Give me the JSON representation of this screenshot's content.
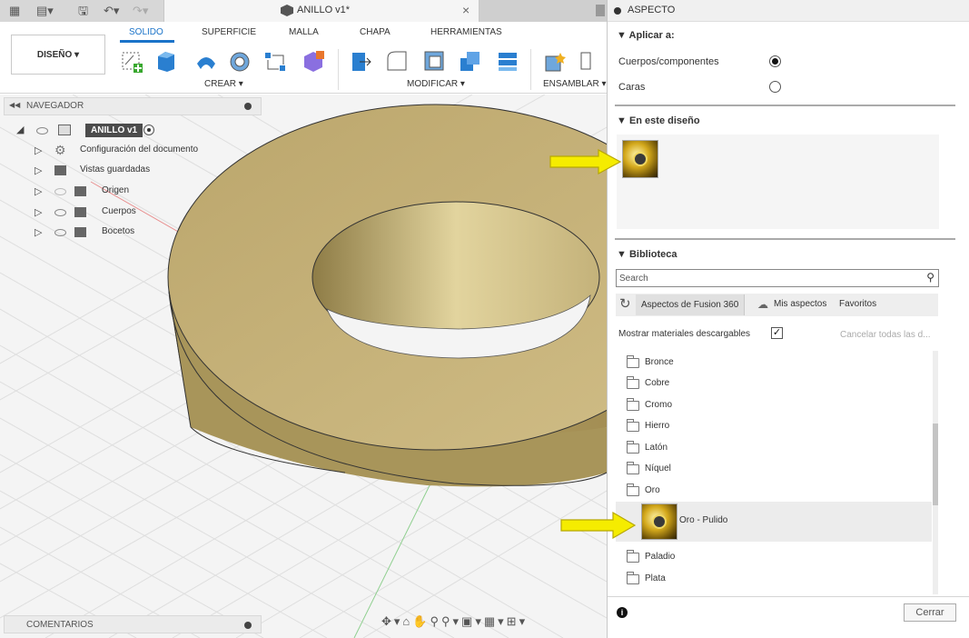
{
  "document_tab": {
    "title": "ANILLO v1*",
    "close": "×"
  },
  "ribbon": {
    "workspace": "DISEÑO ▾",
    "tabs": [
      "SOLIDO",
      "SUPERFICIE",
      "MALLA",
      "CHAPA",
      "HERRAMIENTAS"
    ],
    "groups": [
      "CREAR ▾",
      "MODIFICAR ▾",
      "ENSAMBLAR ▾"
    ]
  },
  "navigator": {
    "header": "NAVEGADOR",
    "root": "ANILLO v1",
    "items": [
      {
        "label": "Configuración del documento",
        "icon": "gear-icon"
      },
      {
        "label": "Vistas guardadas",
        "icon": "folder-icon"
      },
      {
        "label": "Origen",
        "icon": "folder-icon",
        "visibility": "hidden"
      },
      {
        "label": "Cuerpos",
        "icon": "folder-icon",
        "visibility": "visible"
      },
      {
        "label": "Bocetos",
        "icon": "folder-icon",
        "visibility": "visible"
      }
    ]
  },
  "comments": {
    "label": "COMENTARIOS"
  },
  "panel": {
    "title": "ASPECTO",
    "apply_to": {
      "title": "▼ Aplicar a:",
      "options": [
        {
          "label": "Cuerpos/componentes",
          "selected": true
        },
        {
          "label": "Caras",
          "selected": false
        }
      ]
    },
    "in_design": {
      "title": "▼ En este diseño"
    },
    "library": {
      "title": "▼ Biblioteca",
      "search_placeholder": "Search",
      "tabs": [
        "Aspectos de Fusion 360",
        "Mis aspectos",
        "Favoritos"
      ],
      "show_downloadable": "Mostrar materiales descargables",
      "show_downloadable_checked": true,
      "cancel_all": "Cancelar todas las d...",
      "items": [
        "Bronce",
        "Cobre",
        "Cromo",
        "Hierro",
        "Latón",
        "Níquel",
        "Oro",
        "Oro - Pulido",
        "Paladio",
        "Plata"
      ],
      "selected_item": "Oro - Pulido"
    },
    "info": "i",
    "close_button": "Cerrar"
  },
  "colors": {
    "accent": "#1a73c9",
    "ring_gold": "#c8b170",
    "arrow_yellow": "#f5ec00"
  }
}
